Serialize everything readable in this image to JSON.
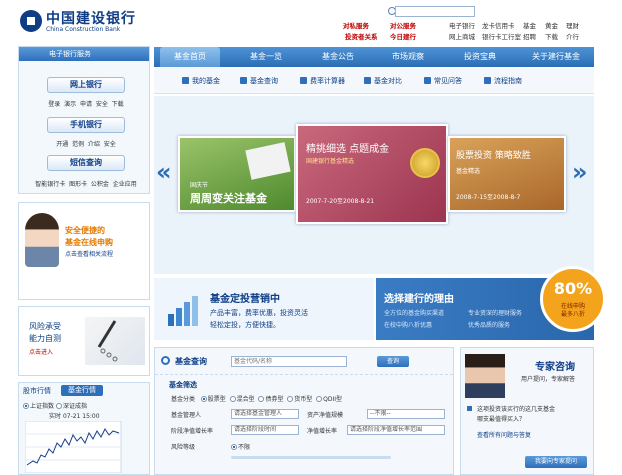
{
  "header": {
    "logo_cn": "中国建设银行",
    "logo_en": "China Construction Bank",
    "promo_links": [
      "对私服务",
      "对公服务",
      "投资者关系",
      "今日建行"
    ],
    "top_links_row1": [
      "电子银行",
      "龙卡信用卡",
      "基金",
      "黄金",
      "理财"
    ],
    "top_links_row2": [
      "网上商城",
      "银行卡工行室",
      "招聘",
      "下载",
      "介行"
    ]
  },
  "sidebar": {
    "title": "电子银行服务",
    "online_bank": "网上银行",
    "online_row": [
      "登录",
      "演示",
      "申请",
      "安全",
      "下载"
    ],
    "mobile_bank": "手机银行",
    "mobile_row": [
      "开通",
      "范例",
      "介绍",
      "安全"
    ],
    "sms": "短信查询",
    "sms_row": [
      "智能银行卡",
      "图形卡",
      "公积金",
      "企业应用"
    ],
    "ad_line1": "安全便捷的",
    "ad_line2": "基金在线申购",
    "ad_line3": "点击查看相关流程",
    "risk_line1": "风险承受",
    "risk_line2": "能力自测",
    "risk_line3": "点击进入",
    "market_tab1": "股市行情",
    "market_tab2": "基金行情",
    "index1": "上证指数",
    "index2": "深证成指",
    "quote_label": "实时",
    "quote_time": "07-21 15:00"
  },
  "nav": {
    "tabs": [
      "基金首页",
      "基金一览",
      "基金公告",
      "市场观察",
      "投资宝典",
      "关于建行基金"
    ],
    "subnav": [
      "我的基金",
      "基金查询",
      "费率计算器",
      "基金对比",
      "常见问答",
      "流程指南"
    ]
  },
  "carousel": {
    "card1_line1": "国庆节",
    "card1_line2": "周周变关注基金",
    "card2_line1": "精挑细选 点题成金",
    "card2_line2": "国建银行基金精选",
    "card2_line3": "2007-7-20至2008-8-21",
    "card3_line1": "股票投资 策略致胜",
    "card3_line2": "基金精选",
    "card3_line3": "2008-7-15至2008-8-7"
  },
  "banners": {
    "ban1_title": "基金定投营销中",
    "ban1_sub1": "产品丰富，费率优惠，投资灵活",
    "ban1_sub2": "轻松定投，方便快捷。",
    "ban2_title": "选择建行的理由",
    "ban2_sub1": "全方位的基金购买渠道",
    "ban2_sub2": "专业资深的理财服务",
    "ban2_sub3": "在校中购八折优惠",
    "ban2_sub4": "优秀品质的服务",
    "badge_value": "80%",
    "badge_line1": "在线申购",
    "badge_line2": "最多八折"
  },
  "fund_search": {
    "title": "基金查询",
    "search_placeholder": "基金代码/名称",
    "search_button": "查询",
    "filter_title": "基金筛选",
    "type_label": "基金分类",
    "types": [
      "股票型",
      "混合型",
      "债券型",
      "货币型",
      "QDII型"
    ],
    "manager_label": "基金管理人",
    "manager_value": "请选择基金管理人",
    "asset_label": "资产净值规模",
    "asset_value": "--不限--",
    "recent_label": "阶段净值增长率",
    "recent_value": "请选择阶段时间",
    "growth_label": "净值增长率",
    "growth_value": "请选择阶段净值增长率范围",
    "risk_label": "风险等级",
    "risk_value": "不限"
  },
  "expert": {
    "title": "专家咨询",
    "sub1": "用户提问，专家解答",
    "q1": "这项投资该买行的这几支基金",
    "q2": "哪支最值得买入？",
    "q3": "查看所有问题与答复",
    "btn": "我要向专家提问"
  }
}
